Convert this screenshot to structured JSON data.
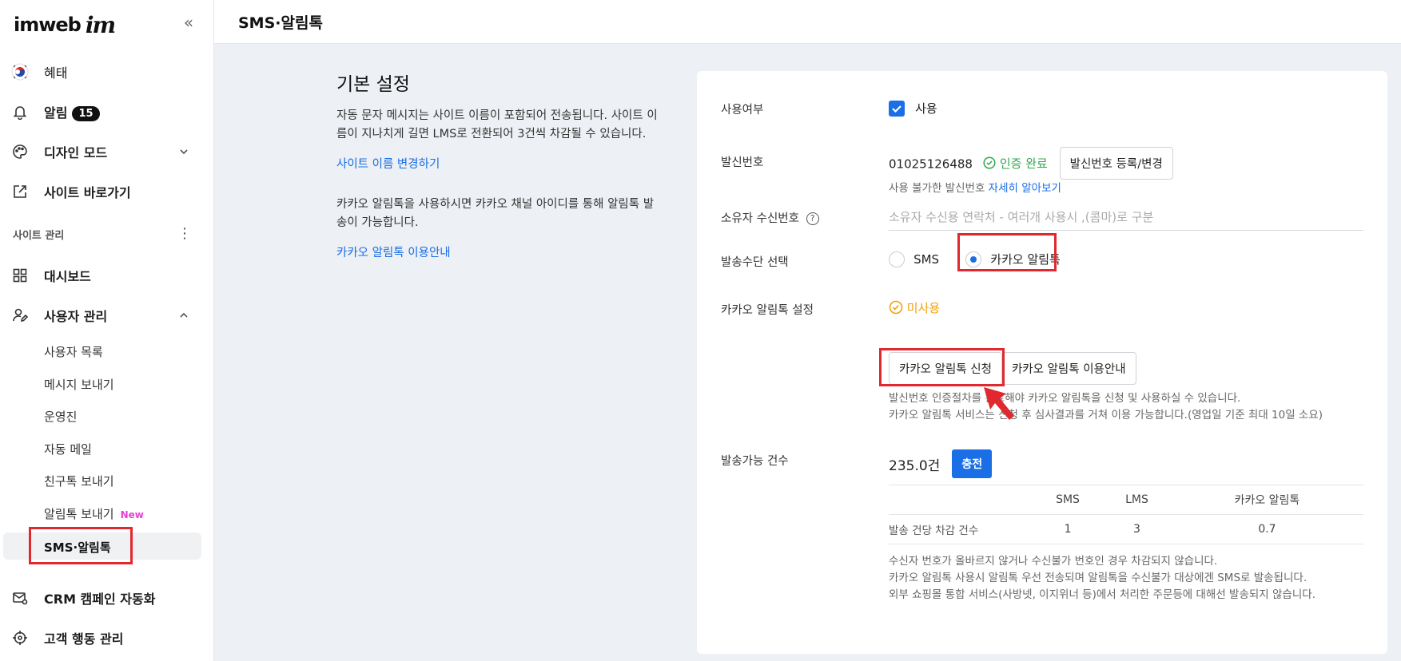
{
  "sidebar": {
    "logo": "imweb",
    "logo_mark": "im",
    "collapse_icon": "«",
    "top_items": [
      {
        "label": "혜태",
        "icon": "korea-flag-icon"
      },
      {
        "label": "알림",
        "badge": "15",
        "icon": "bell-icon"
      },
      {
        "label": "디자인 모드",
        "icon": "palette-icon"
      },
      {
        "label": "사이트 바로가기",
        "icon": "external-link-icon"
      }
    ],
    "section_title": "사이트 관리",
    "manage_items": [
      {
        "label": "대시보드",
        "icon": "dashboard-icon"
      },
      {
        "label": "사용자 관리",
        "icon": "user-edit-icon"
      }
    ],
    "sub_items": [
      {
        "label": "사용자 목록"
      },
      {
        "label": "메시지 보내기"
      },
      {
        "label": "운영진"
      },
      {
        "label": "자동 메일"
      },
      {
        "label": "친구톡 보내기"
      },
      {
        "label": "알림톡 보내기",
        "tag": "New"
      }
    ],
    "active_sub_item": "SMS·알림톡",
    "bottom_items": [
      {
        "label": "CRM 캠페인 자동화",
        "icon": "crm-mail-icon"
      },
      {
        "label": "고객 행동 관리",
        "icon": "target-icon"
      }
    ]
  },
  "header": {
    "title": "SMS·알림톡"
  },
  "intro": {
    "title": "기본 설정",
    "desc1": "자동 문자 메시지는 사이트 이름이 포함되어 전송됩니다. 사이트 이름이 지나치게 길면 LMS로 전환되어 3건씩 차감될 수 있습니다.",
    "link1": "사이트 이름 변경하기",
    "desc2": "카카오 알림톡을 사용하시면 카카오 채널 아이디를 통해 알림톡 발송이 가능합니다.",
    "link2": "카카오 알림톡 이용안내"
  },
  "settings": {
    "use_label": "사용여부",
    "use_value": "사용",
    "sender_label": "발신번호",
    "sender_number": "01025126488",
    "sender_status": "인증 완료",
    "sender_button": "발신번호 등록/변경",
    "sender_hint": "사용 불가한 발신번호",
    "sender_hint_link": "자세히 알아보기",
    "owner_label": "소유자 수신번호",
    "owner_placeholder": "소유자 수신용 연락처 - 여러개 사용시 ,(콤마)로 구분",
    "method_label": "발송수단 선택",
    "method_options": [
      "SMS",
      "카카오 알림톡"
    ],
    "method_selected": "카카오 알림톡",
    "kakao_label": "카카오 알림톡 설정",
    "kakao_status": "미사용",
    "kakao_apply_button": "카카오 알림톡 신청",
    "kakao_guide_button": "카카오 알림톡 이용안내",
    "kakao_hint1": "발신번호 인증절차를 완료해야 카카오 알림톡을 신청 및 사용하실 수 있습니다.",
    "kakao_hint2": "카카오 알림톡 서비스는 신청 후 심사결과를 거쳐 이용 가능합니다.(영업일 기준 최대 10일 소요)",
    "count_label": "발송가능 건수",
    "count_value": "235.0건",
    "charge_button": "충전",
    "table": {
      "headers": [
        "",
        "SMS",
        "LMS",
        "카카오 알림톡"
      ],
      "rows": [
        [
          "발송 건당 차감 건수",
          "1",
          "3",
          "0.7"
        ]
      ]
    },
    "notes": [
      "수신자 번호가 올바르지 않거나 수신불가 번호인 경우 차감되지 않습니다.",
      "카카오 알림톡 사용시 알림톡 우선 전송되며 알림톡을 수신불가 대상에겐 SMS로 발송됩니다.",
      "외부 쇼핑몰 통합 서비스(사방넷, 이지위너 등)에서 처리한 주문등에 대해선 발송되지 않습니다."
    ]
  },
  "colors": {
    "accent": "#1a6ee6",
    "highlight": "#e0282e",
    "success": "#2fa84f",
    "warning": "#f0a20d",
    "new_tag": "#e93fd4"
  }
}
